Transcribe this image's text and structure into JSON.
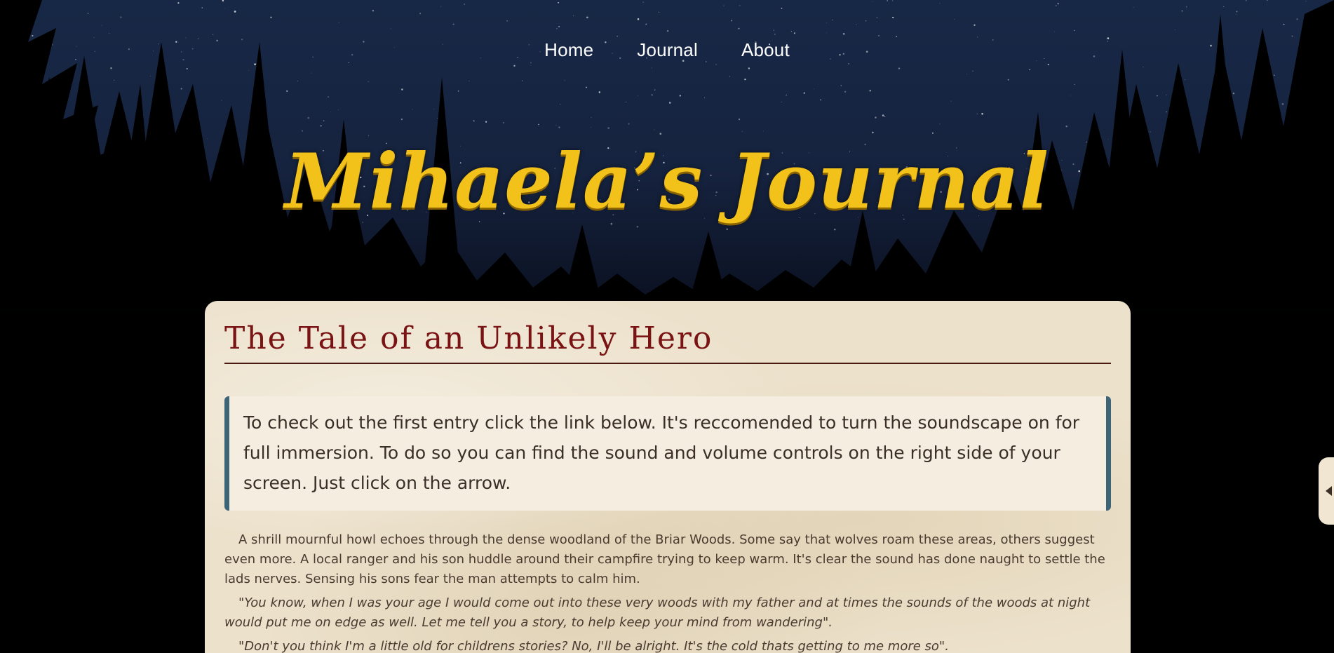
{
  "nav": {
    "items": [
      {
        "label": "Home"
      },
      {
        "label": "Journal"
      },
      {
        "label": "About"
      }
    ]
  },
  "site_title": "Mihaela’s Journal",
  "entry": {
    "title": "The Tale of an Unlikely Hero",
    "notice": "To check out the first entry click the link below. It's reccomended to turn the soundscape on for full immersion. To do so you can find the sound and volume controls on the right side of your screen. Just click on the arrow.",
    "paragraphs": [
      "A shrill mournful howl echoes through the dense woodland of the Briar Woods. Some say that wolves roam these areas, others suggest even more. A local ranger and his son huddle around their campfire trying to keep warm. It's clear the sound has done naught to settle the lads nerves. Sensing his sons fear the man attempts to calm him.",
      "\"You know, when I was your age I would come out into these very woods with my father and at times the sounds of the woods at night would put me on edge as well. Let me tell you a story, to help keep your mind from wandering\".",
      "\"Don't you think I'm a little old for childrens stories? No, I'll be alright. It's the cold thats getting to me more so\"."
    ]
  },
  "sound_panel": {
    "icon": "arrow-left-icon"
  },
  "colors": {
    "title_gold": "#f2c21b",
    "heading_red": "#7a1414",
    "notice_border": "#3e6478",
    "card_bg": "#ece1cb"
  }
}
